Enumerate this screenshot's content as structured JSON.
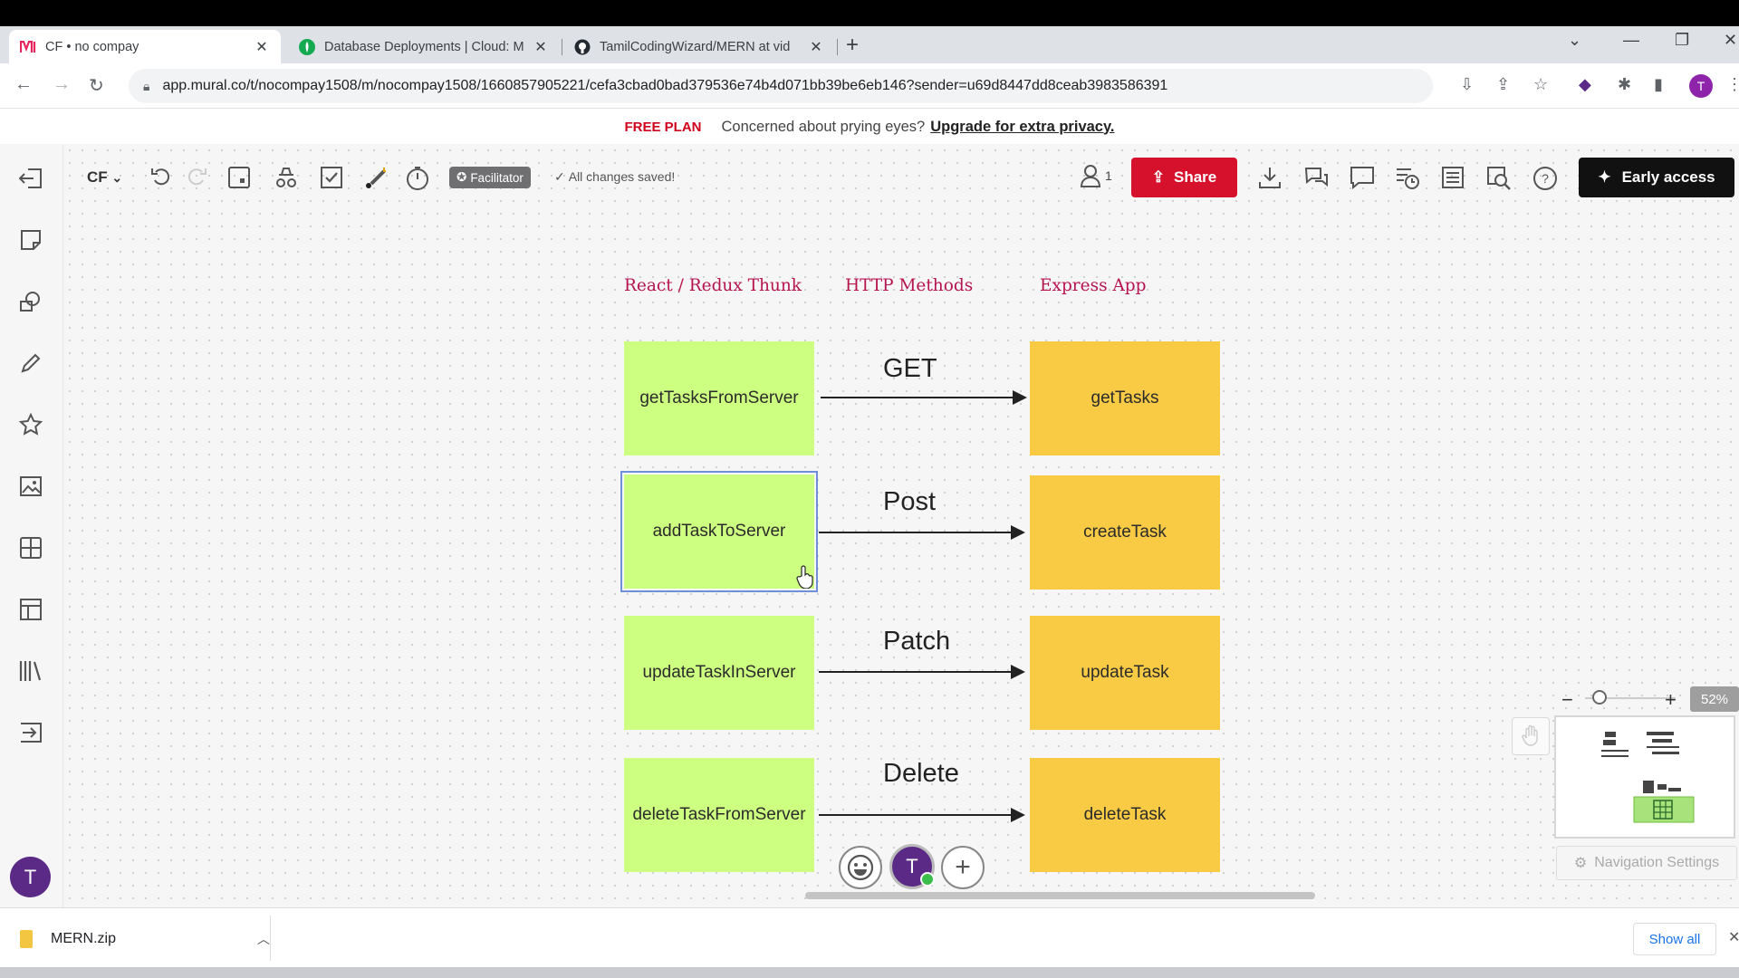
{
  "browser": {
    "tabs": [
      {
        "title": "CF • no compay",
        "favicon": "mural-icon"
      },
      {
        "title": "Database Deployments | Cloud: M",
        "favicon": "mongodb-icon"
      },
      {
        "title": "TamilCodingWizard/MERN at vid",
        "favicon": "github-icon"
      }
    ],
    "url": "app.mural.co/t/nocompay1508/m/nocompay1508/1660857905221/cefa3cbad0bad379536e74b4d071bb39be6eb146?sender=u69d8447dd8ceab3983586391",
    "profile_initial": "T"
  },
  "banner": {
    "plan": "FREE PLAN",
    "message": "Concerned about prying eyes?",
    "upgrade": "Upgrade for extra privacy."
  },
  "toolbar": {
    "board_name": "CF",
    "facilitator": "Facilitator",
    "saved_status": "All changes saved!",
    "user_count": "1",
    "share_label": "Share",
    "early_access_label": "Early access"
  },
  "diagram": {
    "headings": [
      "React / Redux Thunk",
      "HTTP Methods",
      "Express App"
    ],
    "rows": [
      {
        "client": "getTasksFromServer",
        "method": "GET",
        "server": "getTasks"
      },
      {
        "client": "addTaskToServer",
        "method": "Post",
        "server": "createTask"
      },
      {
        "client": "updateTaskInServer",
        "method": "Patch",
        "server": "updateTask"
      },
      {
        "client": "deleteTaskFromServer",
        "method": "Delete",
        "server": "deleteTask"
      }
    ],
    "colors": {
      "client_note": "#cdff80",
      "server_note": "#f9cb45",
      "heading": "#b5144d"
    }
  },
  "collab": {
    "avatar_initial": "T"
  },
  "zoom": {
    "level": "52%"
  },
  "minimap": {
    "nav_settings_label": "Navigation Settings"
  },
  "downloads": {
    "file_name": "MERN.zip",
    "show_all_label": "Show all"
  },
  "sidebar": {
    "avatar_initial": "T"
  }
}
